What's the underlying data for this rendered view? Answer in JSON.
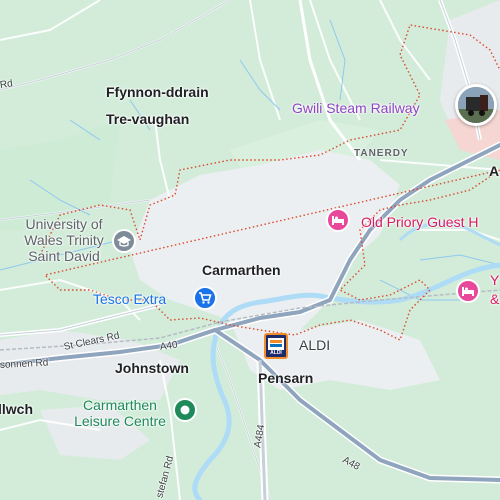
{
  "labels": {
    "ffynnon": "Ffynnon-ddrain",
    "trevaughan": "Tre-vaughan",
    "carmarthen": "Carmarthen",
    "johnstown": "Johnstown",
    "pensarn": "Pensarn",
    "tanerdy": "TANERDY",
    "llwch": "llwch",
    "a_edge": "A"
  },
  "pois": {
    "university": "University of\nWales Trinity\nSaint David",
    "tesco": "Tesco Extra",
    "aldi": "ALDI",
    "leisure": "Carmarthen\nLeisure Centre",
    "gwili": "Gwili Steam Railway",
    "priory": "Old Priory Guest H",
    "y_label": "Y",
    "amp_label": "&"
  },
  "roads": {
    "rd_topleft": "Rd",
    "st_clears": "St Clears Rd",
    "a40": "A40",
    "sonnen": "sonnen Rd",
    "a484": "A484",
    "a48": "A48",
    "stefan": "stefan Rd"
  },
  "icons": {
    "aldi_logo": "ALDI"
  },
  "colors": {
    "land": "#d4eedb",
    "urban": "#eef0f1",
    "water": "#aadaff",
    "highway": "#8fa4bd",
    "boundary": "#d94a2b"
  }
}
